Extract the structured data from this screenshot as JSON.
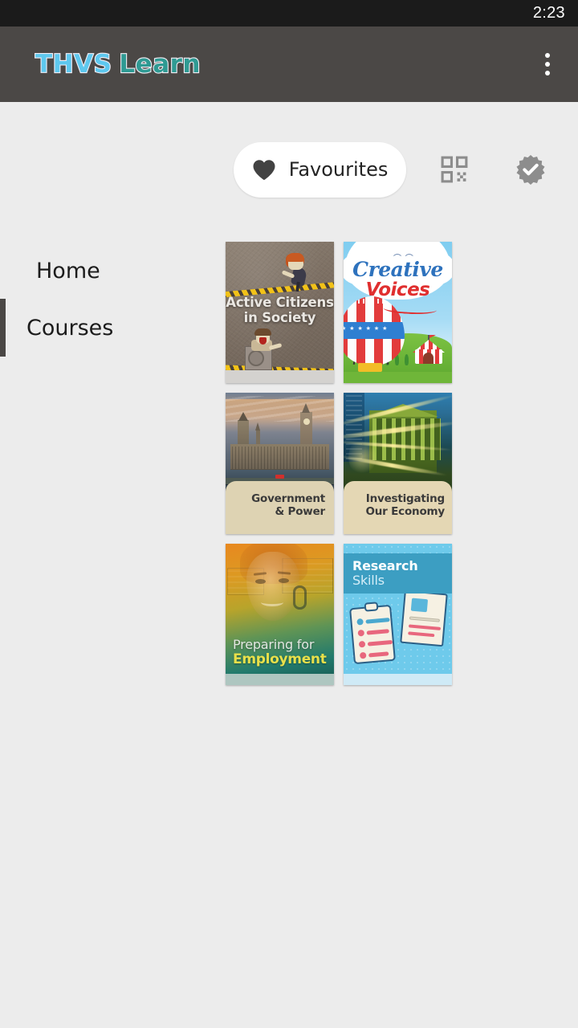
{
  "status_bar": {
    "time": "2:23"
  },
  "app_bar": {
    "brand_part1": "THVS",
    "brand_part2": "Learn",
    "brand_color1": "#5ec8ee",
    "brand_color2": "#2f9a93",
    "background": "#4b4846",
    "overflow_menu": "overflow-menu-icon"
  },
  "sidebar": {
    "items": [
      {
        "label": "Home",
        "selected": false
      },
      {
        "label": "Courses",
        "selected": true
      }
    ],
    "indicator_color": "#4a4745"
  },
  "filters": {
    "favourites": {
      "label": "Favourites",
      "icon": "heart-icon",
      "active": true
    },
    "qr": {
      "icon": "qr-code-icon"
    },
    "badge": {
      "icon": "verified-badge-icon"
    }
  },
  "courses": [
    {
      "title": "Active Citizens in Society",
      "line1": "Active Citizens",
      "line2": "in Society",
      "theme": "brown-textured"
    },
    {
      "title": "Creative Voices",
      "line1": "Creative",
      "line2": "Voices",
      "theme": "sky-balloon"
    },
    {
      "title": "Government & Power",
      "line1": "Government",
      "line2": "& Power",
      "theme": "westminster-photo"
    },
    {
      "title": "Investigating Our Economy",
      "line1": "Investigating",
      "line2": "Our Economy",
      "theme": "city-lights-photo"
    },
    {
      "title": "Preparing for Employment",
      "line1": "Preparing for",
      "line2": "Employment",
      "theme": "portrait-gradient"
    },
    {
      "title": "Research Skills",
      "line1": "Research",
      "line2": "Skills",
      "theme": "blue-clipboard"
    }
  ],
  "colors": {
    "page_background": "#ececec",
    "status_bar": "#1b1b1b",
    "accent_yellow": "#e8e04a"
  }
}
